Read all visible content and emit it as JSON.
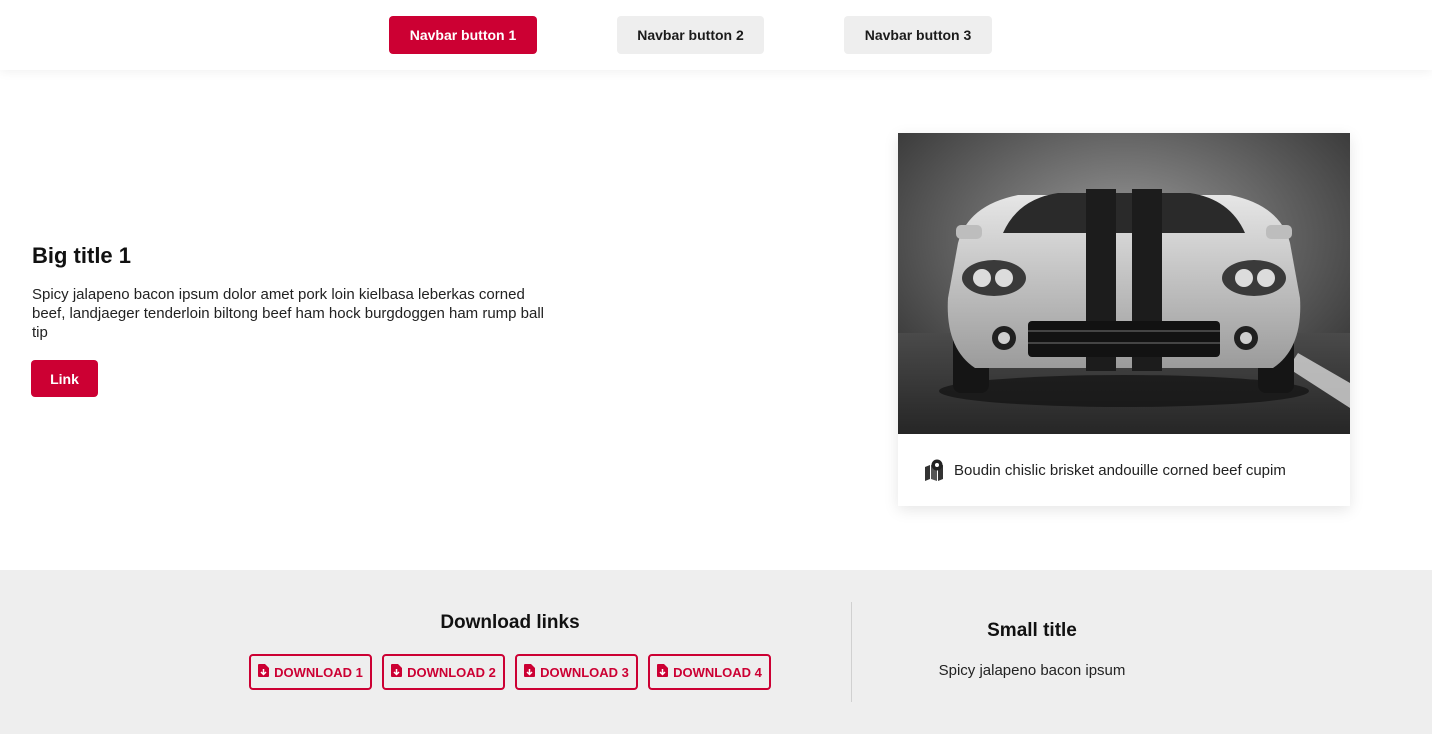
{
  "navbar": {
    "buttons": [
      {
        "label": "Navbar button 1",
        "active": true
      },
      {
        "label": "Navbar button 2",
        "active": false
      },
      {
        "label": "Navbar button 3",
        "active": false
      }
    ]
  },
  "hero": {
    "title": "Big title 1",
    "body": "Spicy jalapeno bacon ipsum dolor amet pork loin kielbasa leberkas corned beef, landjaeger tenderloin biltong beef ham hock burgdoggen ham rump ball tip",
    "link_label": "Link"
  },
  "card": {
    "image_icon": "sports-car-photo",
    "caption_icon": "map-location-icon",
    "caption": "Boudin chislic brisket andouille corned beef cupim"
  },
  "footer": {
    "downloads": {
      "title": "Download links",
      "icon": "file-download-icon",
      "buttons": [
        {
          "label": "DOWNLOAD 1"
        },
        {
          "label": "DOWNLOAD 2"
        },
        {
          "label": "DOWNLOAD 3"
        },
        {
          "label": "DOWNLOAD 4"
        }
      ]
    },
    "aside": {
      "title": "Small title",
      "body": "Spicy jalapeno bacon ipsum"
    }
  },
  "colors": {
    "accent": "#cc0033",
    "nav_secondary_bg": "#eeeeee",
    "footer_bg": "#eeeeee"
  }
}
